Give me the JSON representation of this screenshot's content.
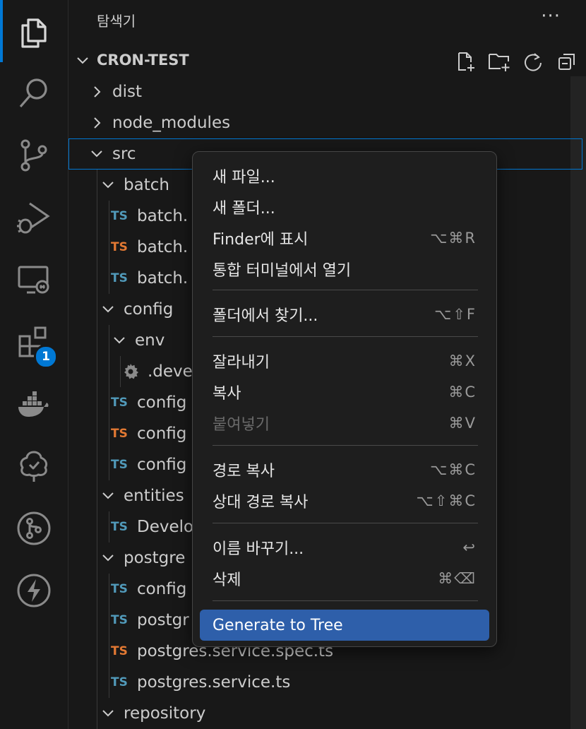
{
  "activity_bar": {
    "extensions_badge": "1"
  },
  "sidebar": {
    "title": "탐색기",
    "more_label": "···",
    "section_title": "CRON-TEST"
  },
  "tree": [
    {
      "label": "dist",
      "kind": "folder",
      "expanded": false
    },
    {
      "label": "node_modules",
      "kind": "folder",
      "expanded": false
    },
    {
      "label": "src",
      "kind": "folder",
      "expanded": true
    },
    {
      "label": "batch",
      "kind": "folder",
      "expanded": true
    },
    {
      "label": "batch.",
      "kind": "ts",
      "color": "blue"
    },
    {
      "label": "batch.",
      "kind": "ts",
      "color": "orange"
    },
    {
      "label": "batch.",
      "kind": "ts",
      "color": "blue"
    },
    {
      "label": "config",
      "kind": "folder",
      "expanded": true
    },
    {
      "label": "env",
      "kind": "folder",
      "expanded": true
    },
    {
      "label": ".deve",
      "kind": "gear"
    },
    {
      "label": "config",
      "kind": "ts",
      "color": "blue"
    },
    {
      "label": "config",
      "kind": "ts",
      "color": "orange"
    },
    {
      "label": "config",
      "kind": "ts",
      "color": "blue"
    },
    {
      "label": "entities",
      "kind": "folder",
      "expanded": true
    },
    {
      "label": "Develo",
      "kind": "ts",
      "color": "blue"
    },
    {
      "label": "postgre",
      "kind": "folder",
      "expanded": true
    },
    {
      "label": "config",
      "kind": "ts",
      "color": "blue"
    },
    {
      "label": "postgr",
      "kind": "ts",
      "color": "blue"
    },
    {
      "label": "postgres.service.spec.ts",
      "kind": "ts",
      "color": "orange"
    },
    {
      "label": "postgres.service.ts",
      "kind": "ts",
      "color": "blue"
    },
    {
      "label": "repository",
      "kind": "folder",
      "expanded": true
    }
  ],
  "ts_label": "TS",
  "menu": {
    "items": [
      {
        "label": "새 파일...",
        "shortcut": ""
      },
      {
        "label": "새 폴더...",
        "shortcut": ""
      },
      {
        "label": "Finder에 표시",
        "shortcut": "⌥⌘R"
      },
      {
        "label": "통합 터미널에서 열기",
        "shortcut": ""
      },
      {
        "label": "폴더에서 찾기...",
        "shortcut": "⌥⇧F"
      },
      {
        "label": "잘라내기",
        "shortcut": "⌘X"
      },
      {
        "label": "복사",
        "shortcut": "⌘C"
      },
      {
        "label": "붙여넣기",
        "shortcut": "⌘V",
        "disabled": true
      },
      {
        "label": "경로 복사",
        "shortcut": "⌥⌘C"
      },
      {
        "label": "상대 경로 복사",
        "shortcut": "⌥⇧⌘C"
      },
      {
        "label": "이름 바꾸기...",
        "shortcut": "↩"
      },
      {
        "label": "삭제",
        "shortcut": "⌘⌫"
      },
      {
        "label": "Generate to Tree",
        "shortcut": "",
        "highlight": true
      }
    ]
  },
  "colors": {
    "accent": "#0078d4",
    "menu_highlight": "#2e5faa",
    "ts_blue": "#519aba",
    "ts_orange": "#e37933"
  }
}
